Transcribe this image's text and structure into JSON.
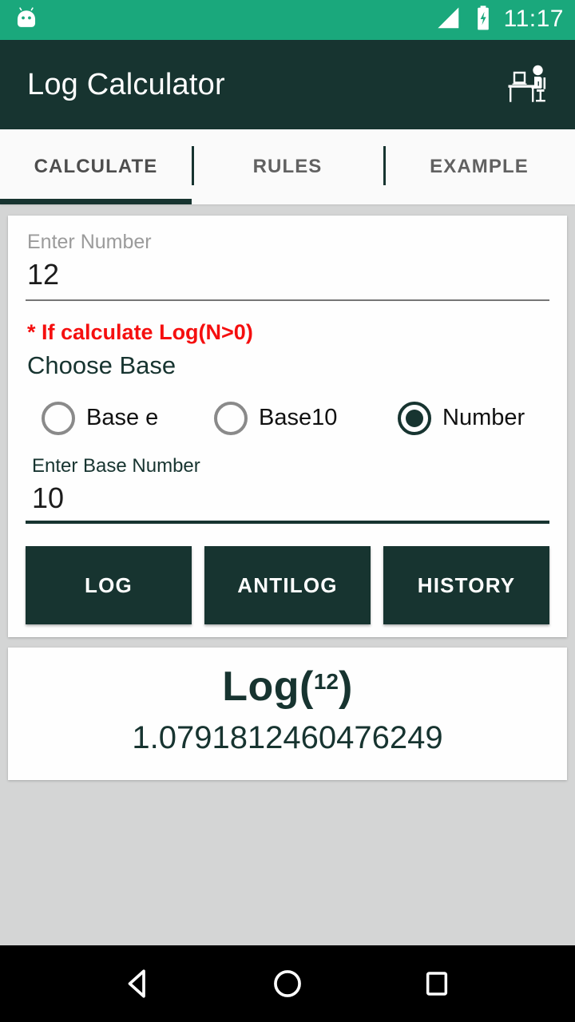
{
  "status_bar": {
    "background": "#1aa87c",
    "clock": "11:17",
    "icons": [
      "android-head-icon",
      "signal-icon",
      "battery-charging-icon"
    ]
  },
  "app_bar": {
    "title": "Log Calculator",
    "background": "#173430",
    "action_icon": "person-at-desk-icon"
  },
  "tabs": {
    "active_index": 0,
    "items": [
      {
        "label": "CALCULATE"
      },
      {
        "label": "RULES"
      },
      {
        "label": "EXAMPLE"
      }
    ]
  },
  "calculate": {
    "number_field": {
      "label": "Enter Number",
      "value": "12",
      "placeholder": "Enter Number"
    },
    "warning": "* If calculate Log(N>0)",
    "choose_base_title": "Choose Base",
    "base_options": [
      {
        "label": "Base e",
        "selected": false
      },
      {
        "label": "Base10",
        "selected": false
      },
      {
        "label": "Number",
        "selected": true
      }
    ],
    "base_field": {
      "label": "Enter Base Number",
      "value": "10",
      "placeholder": "Enter Base Number"
    },
    "buttons": [
      {
        "label": "LOG"
      },
      {
        "label": "ANTILOG"
      },
      {
        "label": "HISTORY"
      }
    ]
  },
  "result": {
    "expr_prefix": "Log(",
    "expr_arg": "12",
    "expr_suffix": ")",
    "value": "1.0791812460476249",
    "color": "#173430"
  },
  "nav_bar": {
    "background": "#000000",
    "buttons": [
      "back-icon",
      "home-icon",
      "recents-icon"
    ]
  }
}
